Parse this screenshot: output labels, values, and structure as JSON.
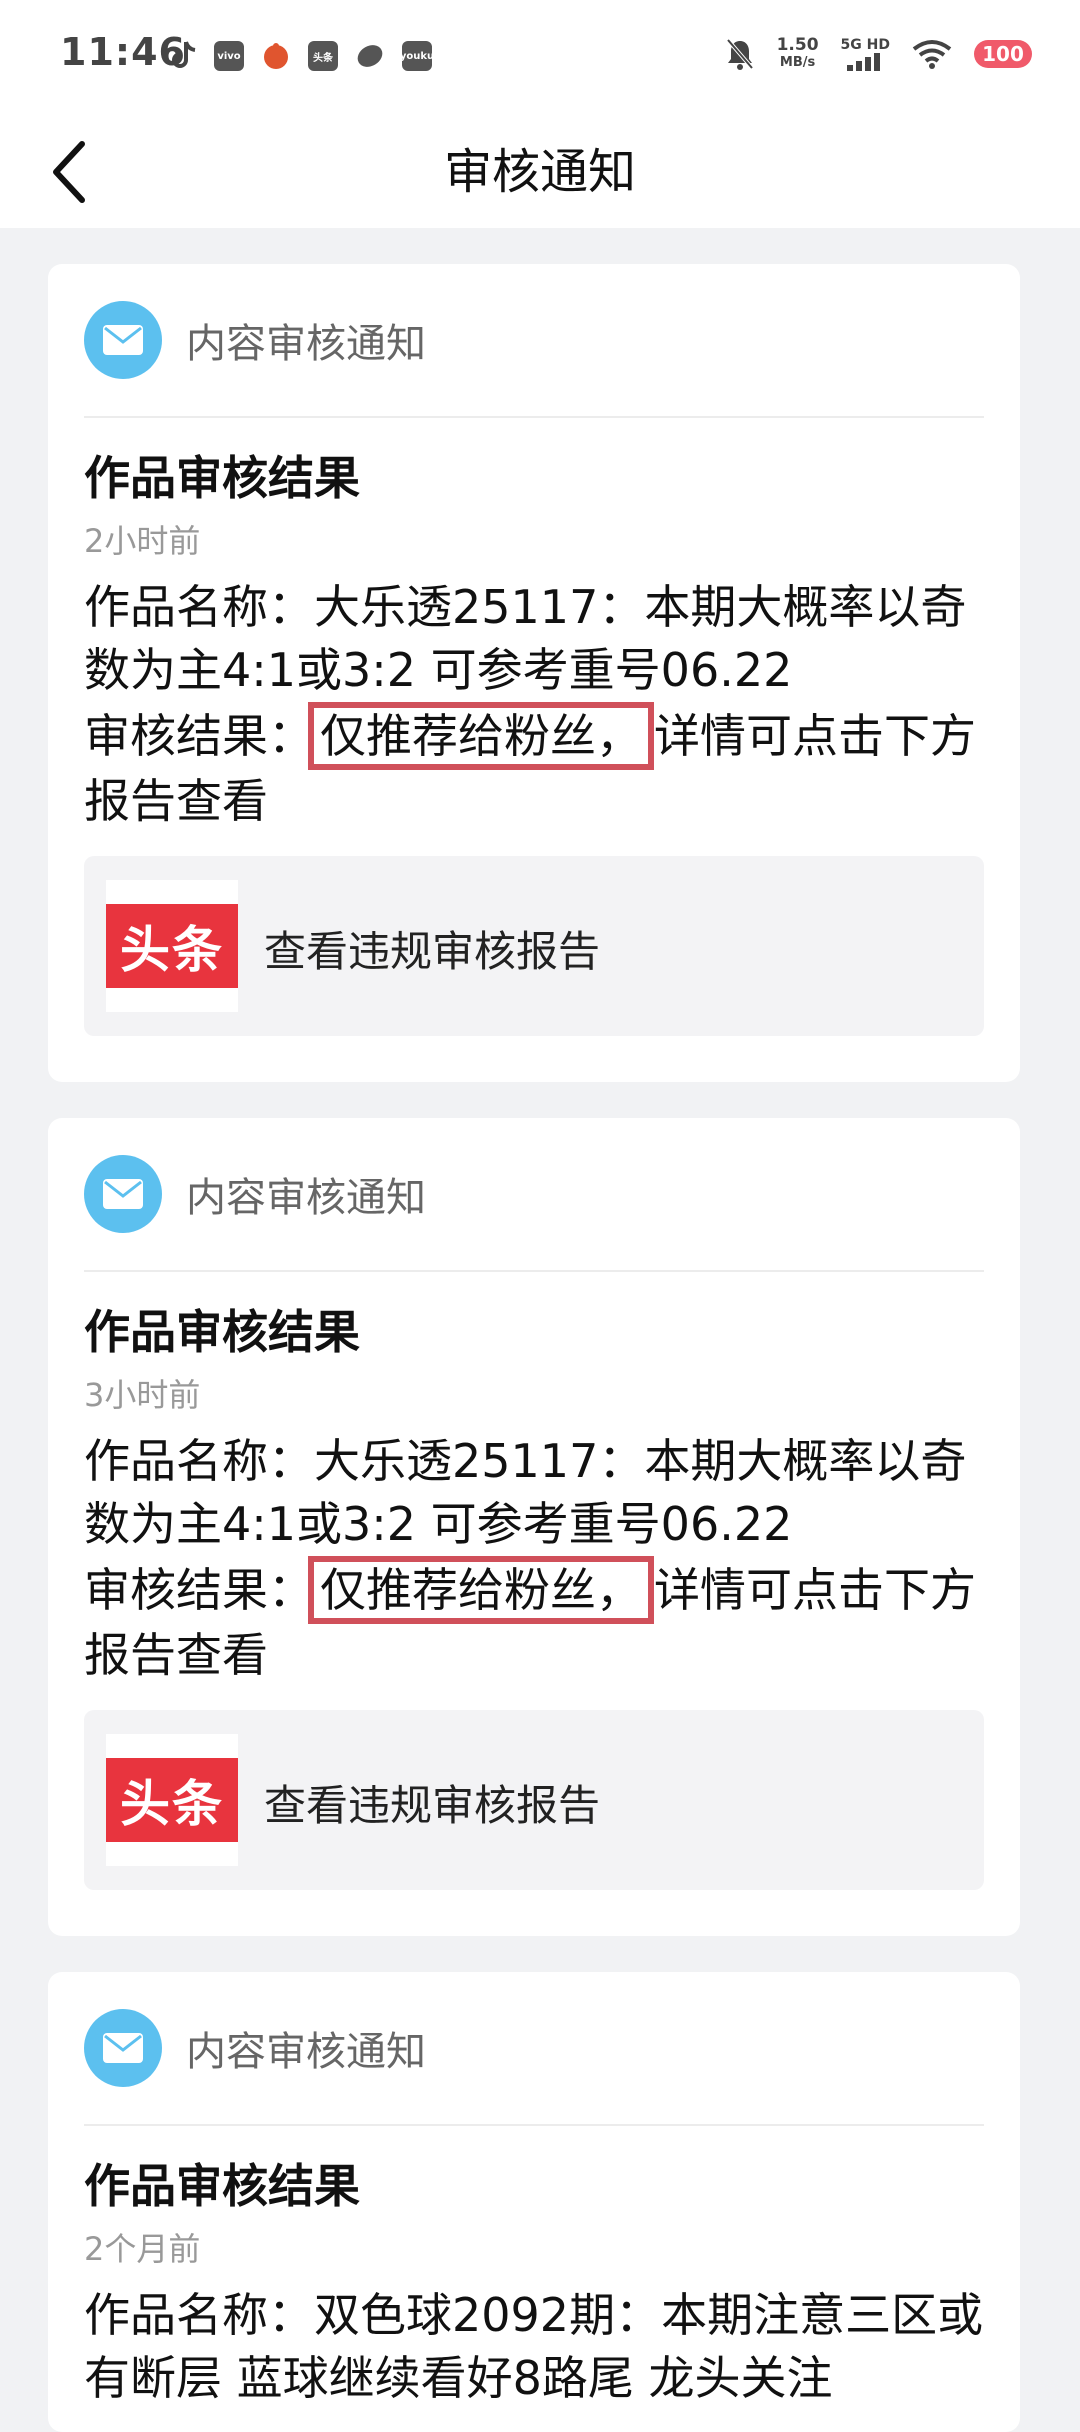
{
  "status_bar": {
    "time": "11:46",
    "app_icons": [
      "vivo",
      "头条",
      "youku"
    ],
    "net_speed_value": "1.50",
    "net_speed_unit": "MB/s",
    "net_type_top": "5G HD",
    "battery": "100"
  },
  "header": {
    "title": "审核通知"
  },
  "cards": [
    {
      "head_label": "内容审核通知",
      "title": "作品审核结果",
      "time": "2小时前",
      "work_line": "作品名称：大乐透25117：本期大概率以奇数为主4:1或3:2 可参考重号06.22",
      "result_prefix": "审核结果：",
      "result_highlight": "仅推荐给粉丝，",
      "result_suffix": "详情可点击下方报告查看",
      "logo_text": "头条",
      "report_label": "查看违规审核报告"
    },
    {
      "head_label": "内容审核通知",
      "title": "作品审核结果",
      "time": "3小时前",
      "work_line": "作品名称：大乐透25117：本期大概率以奇数为主4:1或3:2 可参考重号06.22",
      "result_prefix": "审核结果：",
      "result_highlight": "仅推荐给粉丝，",
      "result_suffix": "详情可点击下方报告查看",
      "logo_text": "头条",
      "report_label": "查看违规审核报告"
    },
    {
      "head_label": "内容审核通知",
      "title": "作品审核结果",
      "time": "2个月前",
      "work_line": "作品名称：双色球2092期：本期注意三区或有断层 蓝球继续看好8路尾 龙头关注"
    }
  ],
  "colors": {
    "accent_blue": "#5cc0ef",
    "highlight_red": "#d0505a",
    "logo_red": "#e8343e"
  }
}
